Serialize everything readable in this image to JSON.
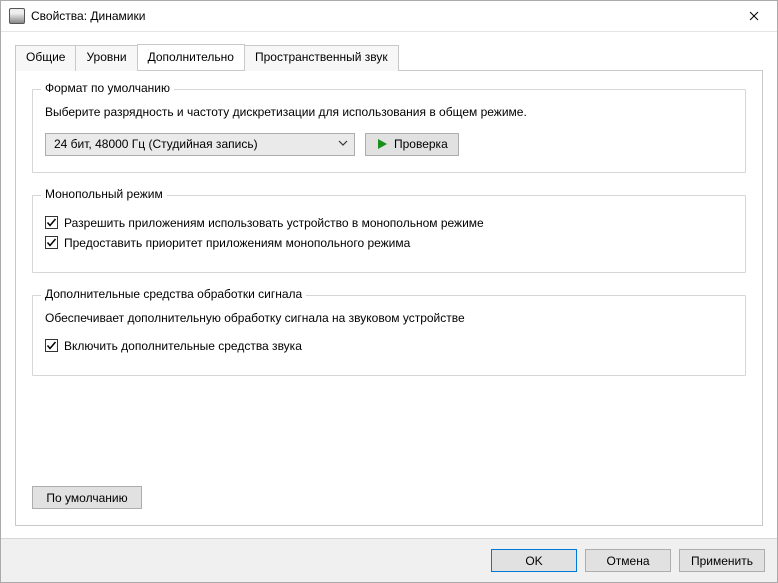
{
  "window": {
    "title": "Свойства: Динамики"
  },
  "tabs": {
    "general": "Общие",
    "levels": "Уровни",
    "advanced": "Дополнительно",
    "spatial": "Пространственный звук"
  },
  "defaultFormat": {
    "legend": "Формат по умолчанию",
    "description": "Выберите разрядность и частоту дискретизации для использования в общем режиме.",
    "selected": "24 бит, 48000 Гц (Студийная запись)",
    "testButton": "Проверка"
  },
  "exclusive": {
    "legend": "Монопольный режим",
    "allow": "Разрешить приложениям использовать устройство в монопольном режиме",
    "priority": "Предоставить приоритет приложениям монопольного режима"
  },
  "enhance": {
    "legend": "Дополнительные средства обработки сигнала",
    "description": "Обеспечивает дополнительную обработку сигнала на звуковом устройстве",
    "enable": "Включить дополнительные средства звука"
  },
  "restoreDefaults": "По умолчанию",
  "footer": {
    "ok": "OK",
    "cancel": "Отмена",
    "apply": "Применить"
  }
}
